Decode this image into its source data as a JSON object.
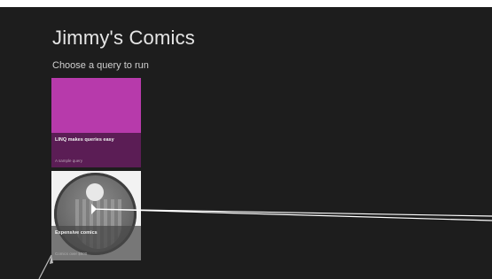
{
  "app": {
    "title": "Jimmy's Comics"
  },
  "page": {
    "subtitle": "Choose a query to run"
  },
  "tiles": [
    {
      "title": "LINQ makes queries easy",
      "subtitle": "A sample query",
      "color": "#b73aab",
      "caption_color": "#5b1d55"
    },
    {
      "title": "Expensive comics",
      "subtitle": "Comics over $500",
      "color": "#f2f2f2",
      "caption_color": "#464646"
    }
  ]
}
